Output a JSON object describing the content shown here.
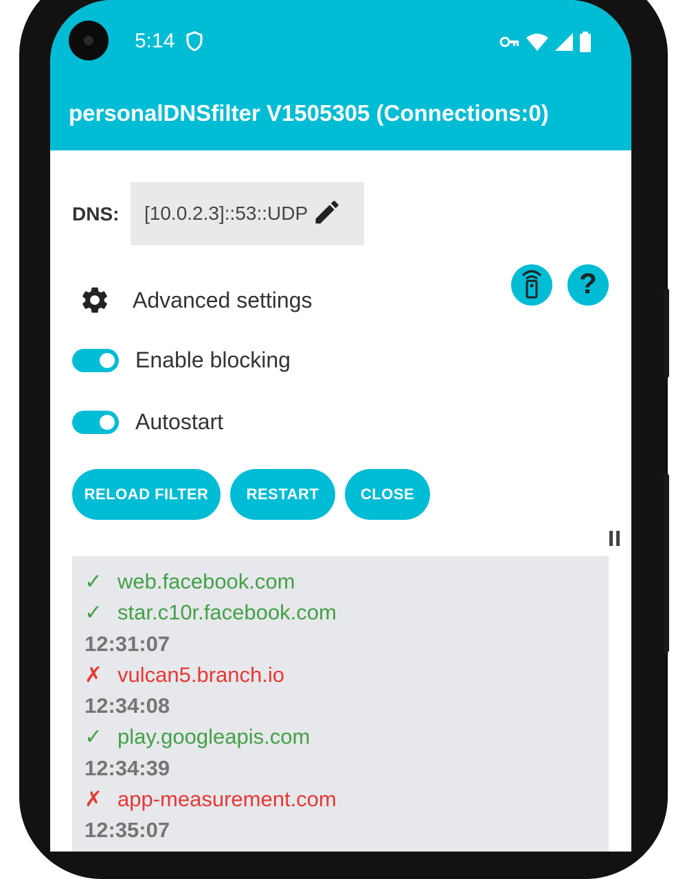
{
  "status_bar": {
    "time": "5:14"
  },
  "app_bar": {
    "title": "personalDNSfilter V1505305 (Connections:0)"
  },
  "dns": {
    "label": "DNS:",
    "value": "[10.0.2.3]::53::UDP"
  },
  "settings": {
    "advanced_label": "Advanced settings",
    "enable_blocking_label": "Enable blocking",
    "enable_blocking_on": true,
    "autostart_label": "Autostart",
    "autostart_on": true
  },
  "buttons": {
    "reload_filter": "RELOAD FILTER",
    "restart": "RESTART",
    "close": "CLOSE"
  },
  "log": [
    {
      "type": "allowed",
      "mark": "✓",
      "text": "web.facebook.com"
    },
    {
      "type": "allowed",
      "mark": "✓",
      "text": "star.c10r.facebook.com"
    },
    {
      "type": "timestamp",
      "mark": "",
      "text": "12:31:07"
    },
    {
      "type": "blocked",
      "mark": "✗",
      "text": "vulcan5.branch.io"
    },
    {
      "type": "timestamp",
      "mark": "",
      "text": "12:34:08"
    },
    {
      "type": "allowed",
      "mark": "✓",
      "text": "play.googleapis.com"
    },
    {
      "type": "timestamp",
      "mark": "",
      "text": "12:34:39"
    },
    {
      "type": "blocked",
      "mark": "✗",
      "text": "app-measurement.com"
    },
    {
      "type": "timestamp",
      "mark": "",
      "text": "12:35:07"
    }
  ],
  "colors": {
    "accent": "#00bcd4",
    "allowed": "#43a047",
    "blocked": "#e53935"
  },
  "icons": {
    "advanced": "gear-icon",
    "dns_edit": "pencil-icon",
    "remote": "remote-control-icon",
    "help": "help-icon",
    "log_control": "pause-icon"
  }
}
